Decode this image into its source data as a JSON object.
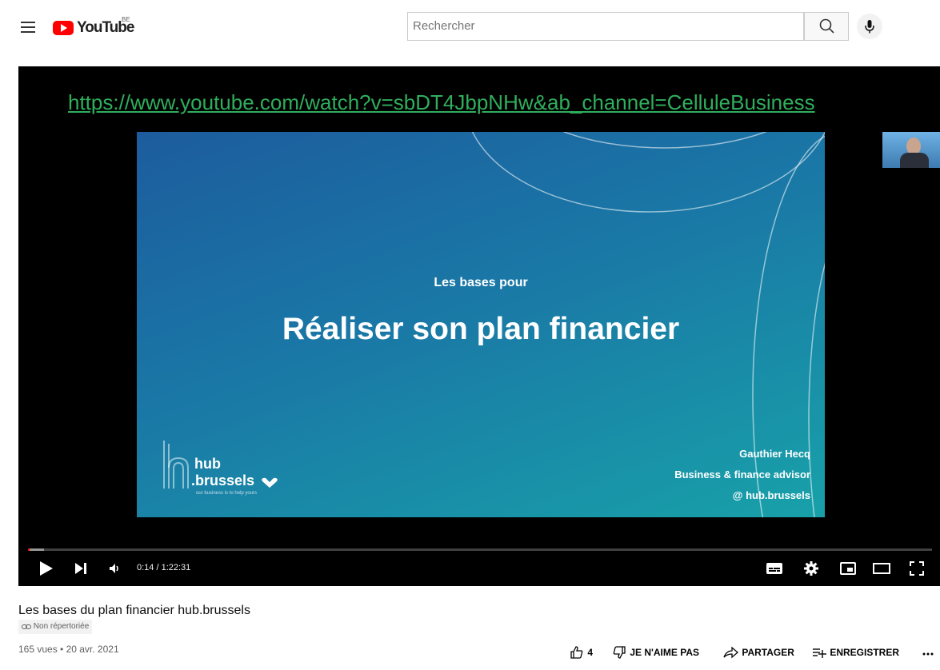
{
  "header": {
    "logo_text": "YouTube",
    "country_code": "BE",
    "search_placeholder": "Rechercher"
  },
  "player": {
    "overlay_url": "https://www.youtube.com/watch?v=sbDT4JbpNHw&ab_channel=CelluleBusiness",
    "slide": {
      "subtitle": "Les bases pour",
      "title": "Réaliser son plan financier",
      "logo_line1": "hub",
      "logo_line2": ".brussels",
      "logo_tagline": "our business is to help yours",
      "speaker_name": "Gauthier Hecq",
      "speaker_role": "Business & finance advisor",
      "speaker_org": "@ hub.brussels"
    },
    "time_display": "0:14 / 1:22:31",
    "progress_played_fraction": 0.002,
    "progress_loaded_fraction": 0.018
  },
  "video": {
    "title": "Les bases du plan financier hub.brussels",
    "visibility_badge": "Non répertoriée",
    "meta": "165 vues • 20 avr. 2021"
  },
  "actions": {
    "like_count": "4",
    "dislike_label": "JE N'AIME PAS",
    "share_label": "PARTAGER",
    "save_label": "ENREGISTRER"
  },
  "colors": {
    "brand_red": "#ff0000",
    "link_green": "#2fae5c",
    "slide_blue": "#1c5c9e",
    "slide_teal": "#18a1a9"
  }
}
